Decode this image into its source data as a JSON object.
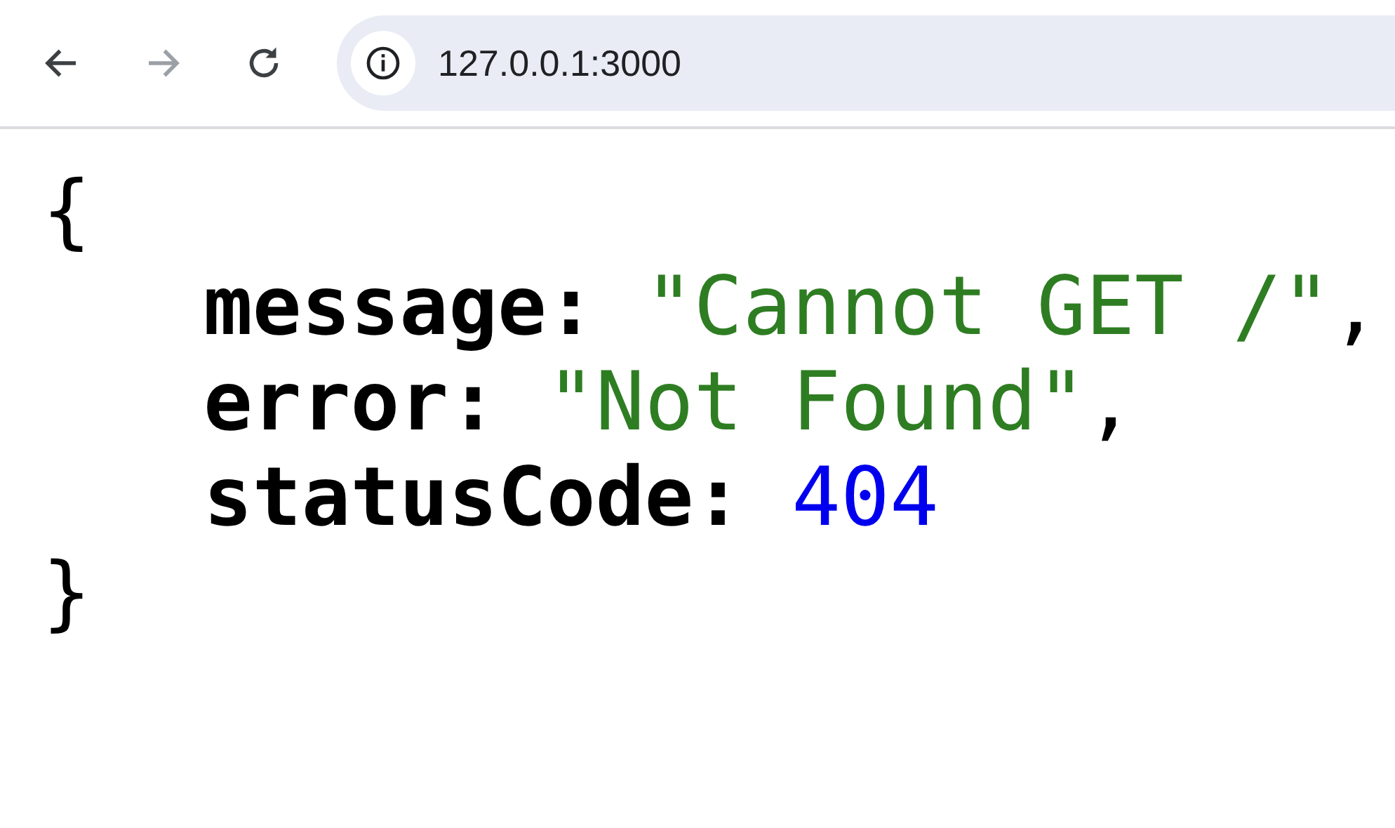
{
  "toolbar": {
    "nav_buttons": [
      {
        "kind": "back",
        "disabled": false
      },
      {
        "kind": "forward",
        "disabled": true
      },
      {
        "kind": "reload",
        "disabled": false
      }
    ],
    "address_bar": {
      "value": "127.0.0.1:3000"
    }
  },
  "json_view": {
    "open": "{",
    "close": "}",
    "entries": [
      {
        "key": "message:",
        "value": "\"Cannot GET /\"",
        "kind": "string",
        "separator": ","
      },
      {
        "key": "error:",
        "value": "\"Not Found\"",
        "kind": "string",
        "separator": ","
      },
      {
        "key": "statusCode:",
        "value": "404",
        "kind": "number"
      }
    ]
  }
}
